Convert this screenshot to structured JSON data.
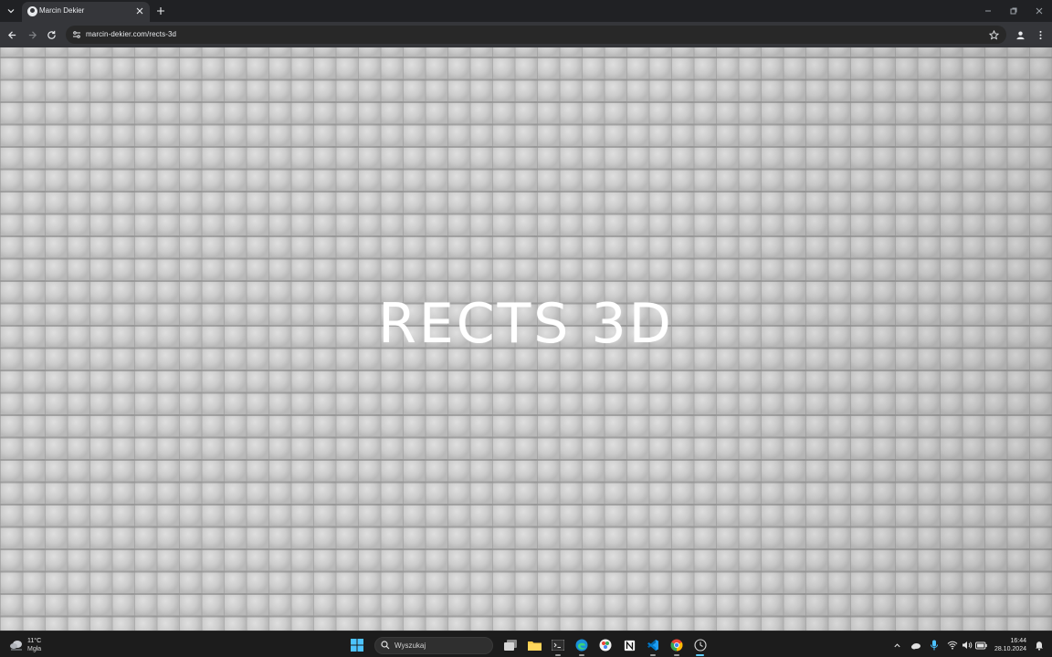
{
  "browser": {
    "tab": {
      "title": "Marcin Dekier"
    },
    "address": {
      "url": "marcin-dekier.com/rects-3d"
    }
  },
  "page": {
    "title": "RECTS 3D"
  },
  "taskbar": {
    "weather": {
      "temperature": "11°C",
      "condition": "Mgła"
    },
    "search": {
      "placeholder": "Wyszukaj"
    },
    "clock": {
      "time": "16:44",
      "date": "28.10.2024"
    }
  }
}
